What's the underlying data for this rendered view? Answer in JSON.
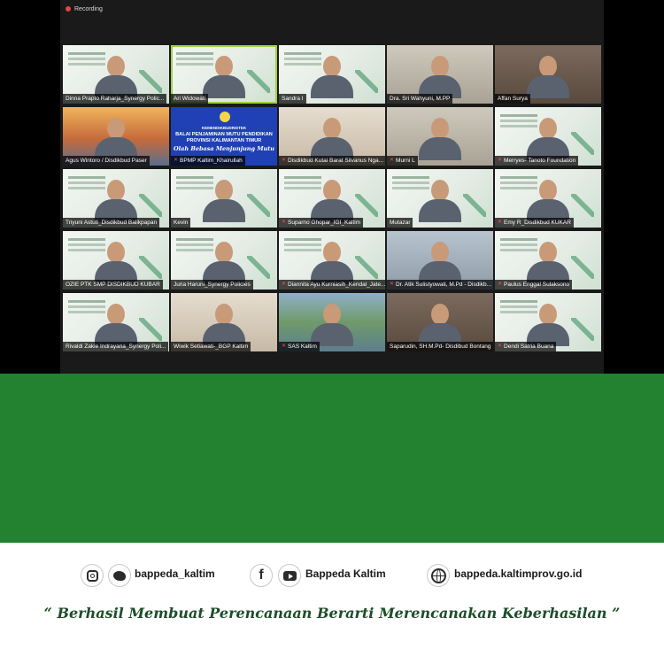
{
  "recording": {
    "label": "Recording"
  },
  "participants": [
    {
      "name": "Dinna Prapto Raharja_Synergy Polic...",
      "scene": "slide",
      "muted": false
    },
    {
      "name": "Ari Widowati",
      "scene": "slide",
      "muted": false,
      "active": true
    },
    {
      "name": "Sandra I",
      "scene": "slide",
      "muted": false
    },
    {
      "name": "Dra. Sri Wahyuni, M.PP",
      "scene": "room",
      "muted": false
    },
    {
      "name": "Affan Surya",
      "scene": "shelf",
      "muted": false
    },
    {
      "name": "Agus Wintoro / Disdikbud Paser",
      "scene": "bridge",
      "muted": false
    },
    {
      "name": "BPMP Kaltim_Khairullah",
      "scene": "banner",
      "muted": true
    },
    {
      "name": "Disdikbud Kutai Barat Silvanus Nga...",
      "scene": "warm",
      "muted": true
    },
    {
      "name": "Murni L",
      "scene": "room",
      "muted": true
    },
    {
      "name": "Merryes- Tanoto Foundation",
      "scene": "slide",
      "muted": true
    },
    {
      "name": "Triyuni Astuti_Disdikbud Balikpapan",
      "scene": "slide",
      "muted": false
    },
    {
      "name": "Kevin",
      "scene": "slide",
      "muted": false
    },
    {
      "name": "Suparno Ghopar_IGI_Kaltim",
      "scene": "slide",
      "muted": true
    },
    {
      "name": "Mutazar",
      "scene": "slide",
      "muted": false
    },
    {
      "name": "Emy R_Disdikbud KUKAR",
      "scene": "slide",
      "muted": true
    },
    {
      "name": "OZIE PTK SMP DISDIKBUD KUBAR",
      "scene": "slide",
      "muted": false
    },
    {
      "name": "Juria Haruni_Synergy Policies",
      "scene": "slide",
      "muted": false
    },
    {
      "name": "Diannita Ayu Kurniasih_Kendal_Jate...",
      "scene": "slide",
      "muted": true
    },
    {
      "name": "Dr. Atik Sulistyowati, M.Pd - Disdikb...",
      "scene": "office",
      "muted": true
    },
    {
      "name": "Paulus Enggal Sulaksono",
      "scene": "slide",
      "muted": true
    },
    {
      "name": "Rivaldi Zakie Indrayana_Synergy Poli...",
      "scene": "slide",
      "muted": false
    },
    {
      "name": "Wiwik Setiawati-_BGP Kaltim",
      "scene": "warm",
      "muted": false
    },
    {
      "name": "SAS Kaltim",
      "scene": "lake",
      "muted": true
    },
    {
      "name": "Saparudin, SH.M.Pd- Disdibud Bontang",
      "scene": "shelf",
      "muted": false
    },
    {
      "name": "Dendi Satria Buana",
      "scene": "slide",
      "muted": true
    }
  ],
  "banner": {
    "ministry": "KEMENDIKBUDRISTEK",
    "title_line1": "BALAI PENJAMINAN MUTU PENDIDIKAN",
    "title_line2": "PROVINSI KALIMANTAN TIMUR",
    "tagline": "Olah Bebasa Menjunjung Mutu"
  },
  "footer": {
    "instagram_twitter_handle": "bappeda_kaltim",
    "facebook_youtube_name": "Bappeda Kaltim",
    "website": "bappeda.kaltimprov.go.id",
    "quote": "“ Berhasil  Membuat Perencanaan Berarti Merencanakan Keberhasilan ”"
  },
  "colors": {
    "green_band": "#23822f",
    "active_speaker_outline": "#9ed13f",
    "mic_muted": "#ff4b4b"
  },
  "icons": [
    "instagram-icon",
    "twitter-icon",
    "facebook-icon",
    "youtube-icon",
    "globe-icon"
  ]
}
